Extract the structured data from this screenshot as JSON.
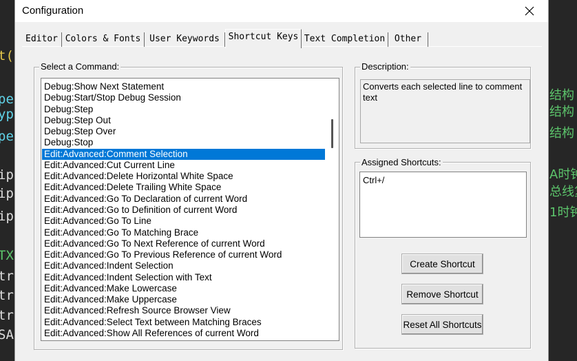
{
  "background": {
    "left_lines": [
      {
        "text": "t(",
        "color": "yellow"
      },
      {
        "text": "pe",
        "color": "cyan"
      },
      {
        "text": "yp",
        "color": "cyan"
      },
      {
        "text": "pe",
        "color": "cyan"
      },
      {
        "text": "ip",
        "color": "default"
      },
      {
        "text": "ip",
        "color": "default"
      },
      {
        "text": "ip",
        "color": "default"
      },
      {
        "text": "TX",
        "color": "green"
      },
      {
        "text": "tr",
        "color": "default"
      },
      {
        "text": "tr",
        "color": "default"
      },
      {
        "text": "tr",
        "color": "default"
      },
      {
        "text": "SA",
        "color": "default"
      }
    ],
    "right_lines": [
      "结构",
      "结构",
      "结构",
      "A时钟",
      "总线复",
      "1时钟"
    ]
  },
  "dialog": {
    "title": "Configuration",
    "tabs": [
      "Editor",
      "Colors & Fonts",
      "User Keywords",
      "Shortcut Keys",
      "Text Completion",
      "Other"
    ],
    "active_tab": "Shortcut Keys",
    "select_label": "Select a Command:",
    "commands": [
      "Debug:Show Next Statement",
      "Debug:Start/Stop Debug Session",
      "Debug:Step",
      "Debug:Step Out",
      "Debug:Step Over",
      "Debug:Stop",
      "Edit:Advanced:Comment Selection",
      "Edit:Advanced:Cut Current Line",
      "Edit:Advanced:Delete Horizontal White Space",
      "Edit:Advanced:Delete Trailing White Space",
      "Edit:Advanced:Go To Declaration of current Word",
      "Edit:Advanced:Go to Definition of current Word",
      "Edit:Advanced:Go To Line",
      "Edit:Advanced:Go To Matching Brace",
      "Edit:Advanced:Go To Next Reference of current Word",
      "Edit:Advanced:Go To Previous Reference of current Word",
      "Edit:Advanced:Indent Selection",
      "Edit:Advanced:Indent Selection with Text",
      "Edit:Advanced:Make Lowercase",
      "Edit:Advanced:Make Uppercase",
      "Edit:Advanced:Refresh Source Browser View",
      "Edit:Advanced:Select Text between Matching Braces",
      "Edit:Advanced:Show All References of current Word"
    ],
    "selected_command": "Edit:Advanced:Comment Selection",
    "description_label": "Description:",
    "description_text": "Converts each selected line to comment text",
    "assigned_label": "Assigned Shortcuts:",
    "assigned_shortcuts": [
      "Ctrl+/"
    ],
    "buttons": {
      "create": "Create Shortcut",
      "remove": "Remove Shortcut",
      "reset": "Reset All Shortcuts"
    }
  },
  "colors": {
    "selection": "#0078d7",
    "dialog_bg": "#f0f0f0",
    "editor_bg": "#262626"
  }
}
